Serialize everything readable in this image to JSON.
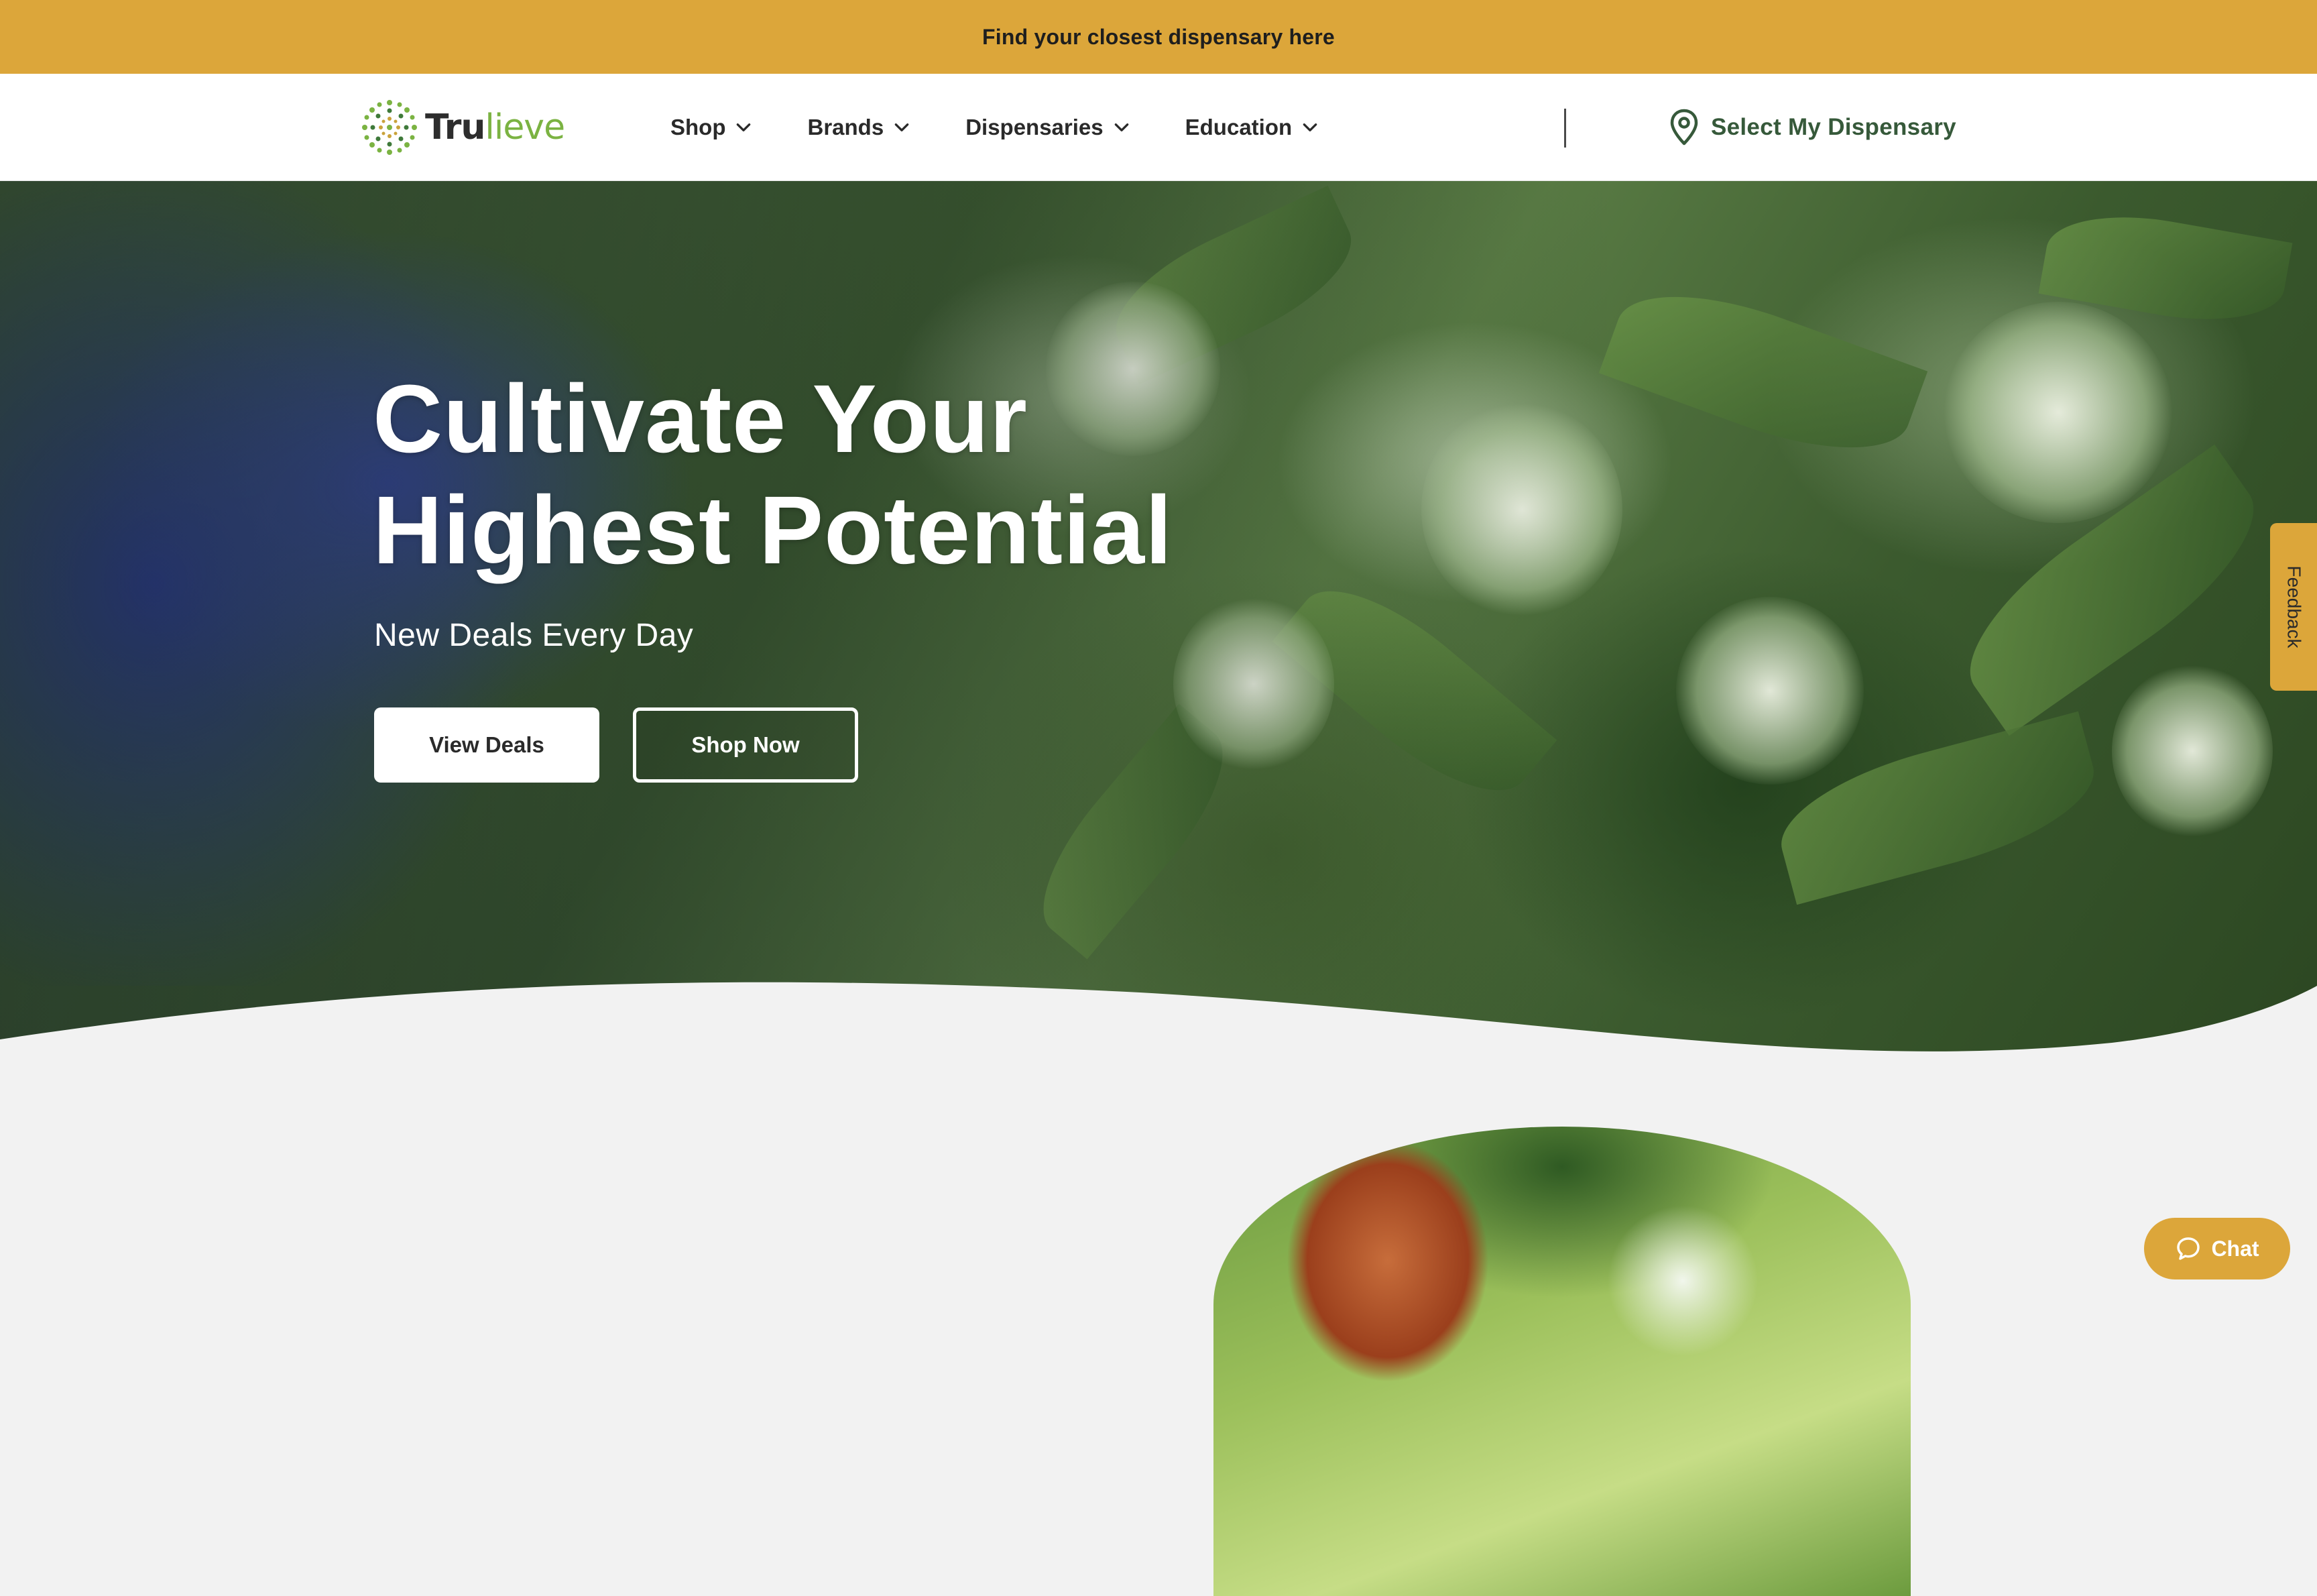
{
  "banner": {
    "text": "Find your closest dispensary here"
  },
  "brand": {
    "name_part1": "Tru",
    "name_part2": "lieve"
  },
  "nav": {
    "items": [
      {
        "label": "Shop"
      },
      {
        "label": "Brands"
      },
      {
        "label": "Dispensaries"
      },
      {
        "label": "Education"
      }
    ],
    "select_dispensary": "Select My Dispensary"
  },
  "hero": {
    "title_line1": "Cultivate Your",
    "title_line2": "Highest Potential",
    "subtitle": "New Deals Every Day",
    "primary_button": "View Deals",
    "secondary_button": "Shop Now"
  },
  "feedback": {
    "label": "Feedback"
  },
  "chat": {
    "label": "Chat"
  },
  "colors": {
    "accent": "#dca63a",
    "brand_green": "#7bb342",
    "dispensary_link": "#36593a",
    "page_bg": "#f2f2f2"
  },
  "icons": [
    "sunburst-logo-icon",
    "chevron-down-icon",
    "location-pin-icon",
    "chat-bubble-icon"
  ]
}
